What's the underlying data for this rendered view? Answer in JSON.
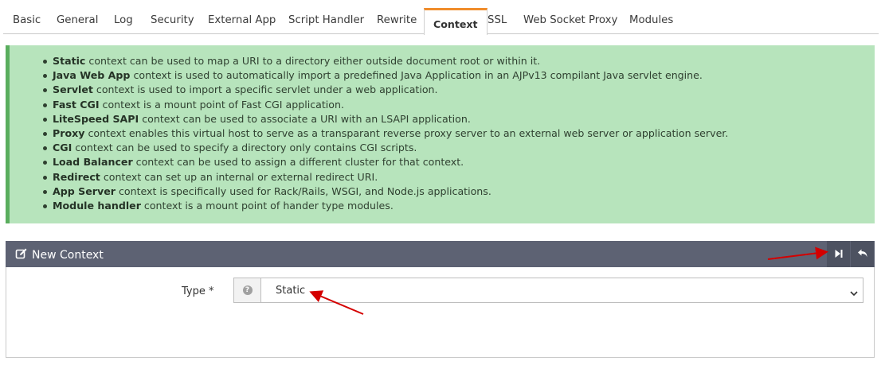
{
  "tabs": [
    {
      "label": "Basic",
      "active": false
    },
    {
      "label": "General",
      "active": false
    },
    {
      "label": "Log",
      "active": false
    },
    {
      "label": "Security",
      "active": false
    },
    {
      "label": "External App",
      "active": false
    },
    {
      "label": "Script Handler",
      "active": false
    },
    {
      "label": "Rewrite",
      "active": false
    },
    {
      "label": "Context",
      "active": true
    },
    {
      "label": "SSL",
      "active": false
    },
    {
      "label": "Web Socket Proxy",
      "active": false
    },
    {
      "label": "Modules",
      "active": false
    }
  ],
  "info": {
    "items": [
      {
        "term": "Static",
        "text": " context can be used to map a URI to a directory either outside document root or within it."
      },
      {
        "term": "Java Web App",
        "text": " context is used to automatically import a predefined Java Application in an AJPv13 compilant Java servlet engine."
      },
      {
        "term": "Servlet",
        "text": " context is used to import a specific servlet under a web application."
      },
      {
        "term": "Fast CGI",
        "text": " context is a mount point of Fast CGI application."
      },
      {
        "term": "LiteSpeed SAPI",
        "text": " context can be used to associate a URI with an LSAPI application."
      },
      {
        "term": "Proxy",
        "text": " context enables this virtual host to serve as a transparant reverse proxy server to an external web server or application server."
      },
      {
        "term": "CGI",
        "text": " context can be used to specify a directory only contains CGI scripts."
      },
      {
        "term": "Load Balancer",
        "text": " context can be used to assign a different cluster for that context."
      },
      {
        "term": "Redirect",
        "text": " context can set up an internal or external redirect URI."
      },
      {
        "term": "App Server",
        "text": " context is specifically used for Rack/Rails, WSGI, and Node.js applications."
      },
      {
        "term": "Module handler",
        "text": " context is a mount point of hander type modules."
      }
    ]
  },
  "panel": {
    "title": "New Context",
    "title_icon": "edit-icon",
    "next_icon": "step-forward-icon",
    "back_icon": "reply-icon",
    "header_color": "#5d6273"
  },
  "form": {
    "type_label": "Type *",
    "help_icon": "question-circle-icon",
    "type_value": "Static"
  },
  "colors": {
    "info_bg": "#b7e4bc",
    "info_border": "#5aae5e",
    "active_tab_accent": "#f08c2b",
    "annotation_arrow": "#d40000"
  }
}
